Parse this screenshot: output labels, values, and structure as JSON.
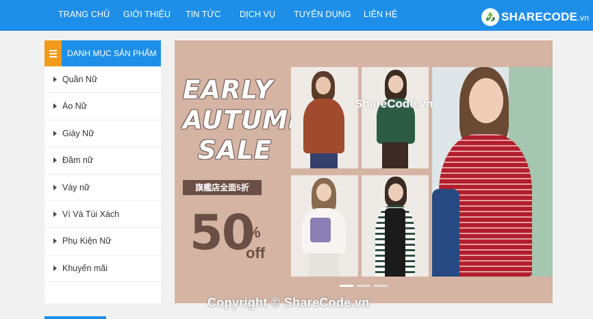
{
  "nav": {
    "items": [
      {
        "label": "TRANG CHỦ"
      },
      {
        "label": "GIỚI THIỆU"
      },
      {
        "label": "TIN TỨC"
      },
      {
        "label": "DỊCH VỤ"
      },
      {
        "label": "TUYỂN DỤNG"
      },
      {
        "label": "LIÊN HỆ"
      }
    ],
    "logo_main": "SHARECODE",
    "logo_suffix": ".vn"
  },
  "sidebar": {
    "title": "DANH MỤC SẢN PHẨM",
    "items": [
      {
        "label": "Quần Nữ"
      },
      {
        "label": "Áo Nữ"
      },
      {
        "label": "Giày Nữ"
      },
      {
        "label": "Đầm nữ"
      },
      {
        "label": "Váy nữ"
      },
      {
        "label": "Ví Và Túi Xách"
      },
      {
        "label": "Phụ Kiện Nữ"
      },
      {
        "label": "Khuyến mãi"
      }
    ]
  },
  "banner": {
    "line1": "EARLY",
    "line2": "AUTUMN",
    "line3": "SALE",
    "store_text": "旗艦店全面5折",
    "discount_number": "50",
    "discount_sign": "%",
    "discount_off": "off",
    "slide_count": 3,
    "active_slide": 1
  },
  "watermarks": {
    "center": "ShareCode.vn",
    "footer": "Copyright © ShareCode.vn"
  },
  "colors": {
    "primary": "#1e8fe9",
    "accent": "#f29a1b",
    "banner_bg": "#d5b4a4",
    "banner_text": "#6b4e44"
  }
}
